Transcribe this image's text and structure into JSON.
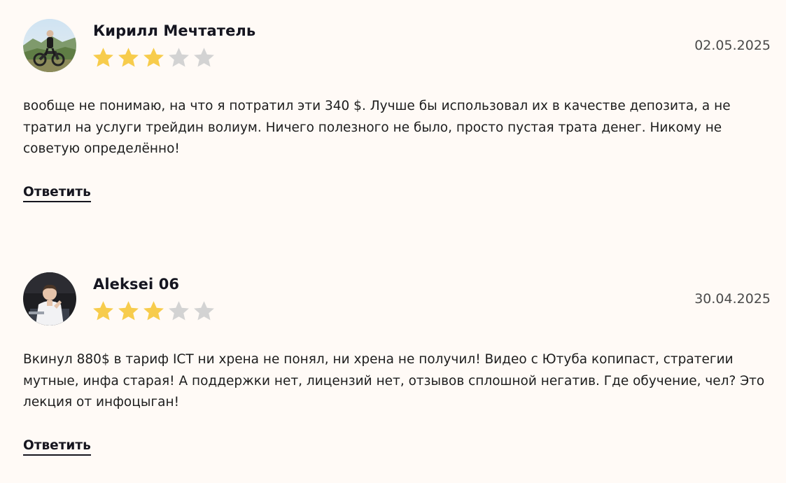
{
  "reviews": [
    {
      "author": "Кирилл Мечтатель",
      "rating": 3,
      "max_rating": 5,
      "date": "02.05.2025",
      "text": "вообще не понимаю, на что я потратил эти 340 $. Лучше бы использовал их в качестве депозита, а не тратил на услуги трейдин волиум. Ничего полезного не было, просто пустая трата денег. Никому не советую определённо!",
      "reply_label": "Ответить"
    },
    {
      "author": "Aleksei 06",
      "rating": 3,
      "max_rating": 5,
      "date": "30.04.2025",
      "text": "Вкинул 880$ в тариф ICT ни хрена не понял, ни хрена не получил! Видео с Ютуба копипаст, стратегии мутные, инфа старая! А поддержки нет, лицензий нет, отзывов сплошной негатив. Где обучение, чел? Это лекция от инфоцыган!",
      "reply_label": "Ответить"
    }
  ],
  "colors": {
    "background": "#fffaf6",
    "star_filled": "#f7cc4c",
    "star_empty": "#d3d3d3",
    "text": "#1d1d1d"
  }
}
